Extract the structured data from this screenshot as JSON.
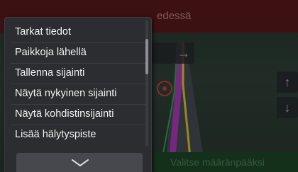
{
  "map": {
    "banner_text": "edessä",
    "bottom_button_label": "Valitse määränpääksi",
    "arrow_up": "↑",
    "arrow_down": "↓",
    "arrow_right": "→",
    "icons": [
      "arrow-up-icon",
      "arrow-down-icon",
      "arrow-right-icon",
      "cursor-marker-icon"
    ]
  },
  "menu": {
    "items": [
      {
        "label": "Tarkat tiedot"
      },
      {
        "label": "Paikkoja lähellä"
      },
      {
        "label": "Tallenna sijainti"
      },
      {
        "label": "Näytä nykyinen sijainti"
      },
      {
        "label": "Näytä kohdistinsijainti"
      },
      {
        "label": "Lisää hälytyspiste"
      }
    ],
    "more_icon": "chevron-down-icon"
  },
  "colors": {
    "menu_background": "#2c2d31",
    "menu_text": "#f2f2f2",
    "banner": "#5e1b1b",
    "confirm_bar": "#1f4a2a"
  }
}
